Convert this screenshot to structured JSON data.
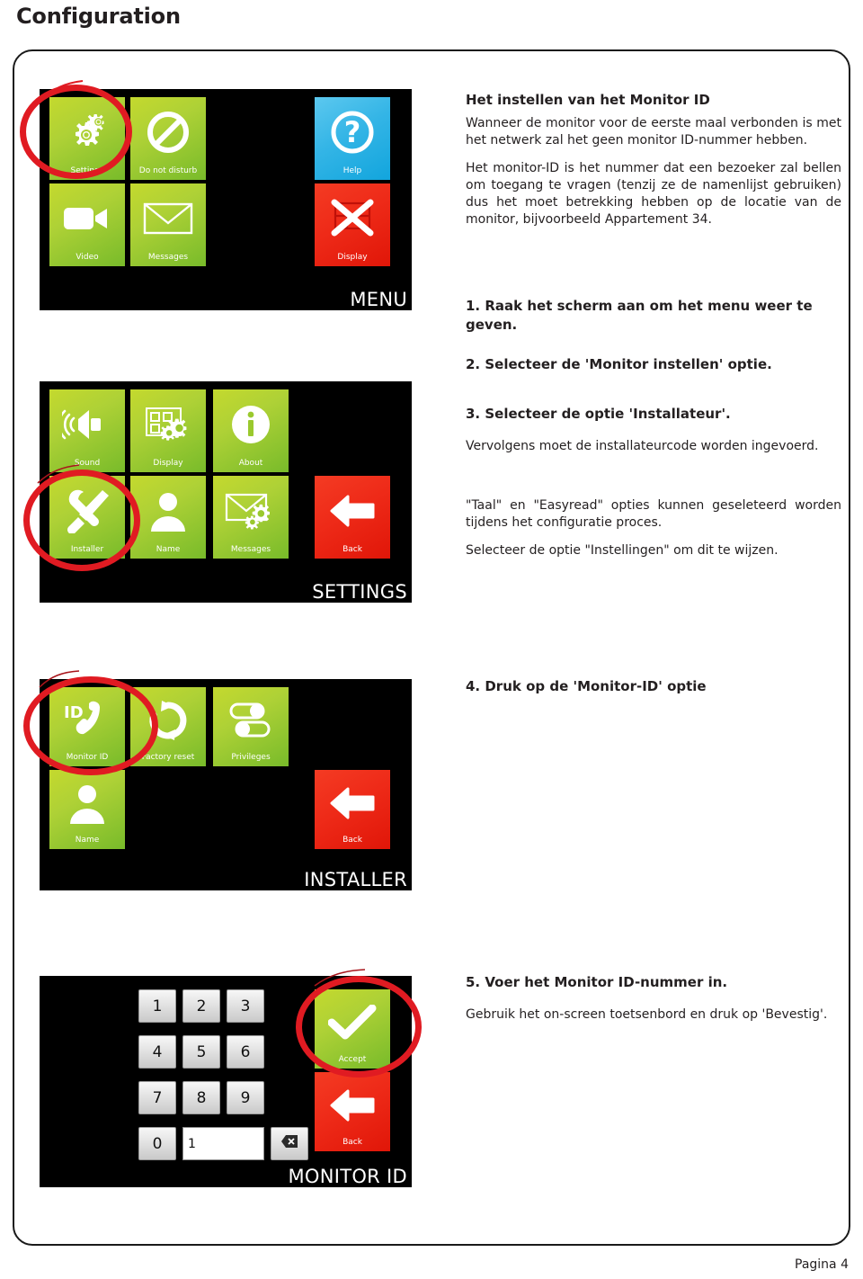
{
  "page": {
    "title": "Configuration",
    "footer": "Pagina 4"
  },
  "colors": {
    "green": "#aed136",
    "red": "#e01608",
    "blue": "#34b5e6",
    "annotation": "#e01b22",
    "screen_bg": "#000000"
  },
  "screens": [
    {
      "name": "menu-screen",
      "caption": "MENU",
      "tiles": [
        {
          "label": "Settings",
          "icon": "gears-icon",
          "color": "green"
        },
        {
          "label": "Do not disturb",
          "icon": "no-entry-icon",
          "color": "green"
        },
        {
          "label": "Help",
          "icon": "question-circle-icon",
          "color": "blue"
        },
        {
          "label": "Video",
          "icon": "video-camera-icon",
          "color": "green"
        },
        {
          "label": "Messages",
          "icon": "envelope-icon",
          "color": "green"
        },
        {
          "label": "Display",
          "icon": "display-off-icon",
          "color": "red"
        }
      ],
      "highlight": "Settings"
    },
    {
      "name": "settings-screen",
      "caption": "SETTINGS",
      "tiles": [
        {
          "label": "Sound",
          "icon": "speaker-icon",
          "color": "green"
        },
        {
          "label": "Display",
          "icon": "display-gears-icon",
          "color": "green"
        },
        {
          "label": "About",
          "icon": "info-circle-icon",
          "color": "green"
        },
        {
          "label": "Installer",
          "icon": "tools-icon",
          "color": "green"
        },
        {
          "label": "Name",
          "icon": "person-icon",
          "color": "green"
        },
        {
          "label": "Messages",
          "icon": "envelope-gears-icon",
          "color": "green"
        },
        {
          "label": "Back",
          "icon": "arrow-left-icon",
          "color": "red"
        }
      ],
      "highlight": "Installer"
    },
    {
      "name": "installer-screen",
      "caption": "INSTALLER",
      "tiles": [
        {
          "label": "Monitor ID",
          "icon": "id-phone-icon",
          "color": "green"
        },
        {
          "label": "Factory reset",
          "icon": "refresh-icon",
          "color": "green"
        },
        {
          "label": "Privileges",
          "icon": "toggles-icon",
          "color": "green"
        },
        {
          "label": "Name",
          "icon": "person-icon",
          "color": "green"
        },
        {
          "label": "Back",
          "icon": "arrow-left-icon",
          "color": "red"
        }
      ],
      "highlight": "Monitor ID"
    },
    {
      "name": "monitor-id-screen",
      "caption": "MONITOR ID",
      "keys": [
        "1",
        "2",
        "3",
        "4",
        "5",
        "6",
        "7",
        "8",
        "9",
        "0"
      ],
      "input_value": "1",
      "backspace_icon": "backspace-icon",
      "tiles": [
        {
          "label": "Accept",
          "icon": "check-icon",
          "color": "green"
        },
        {
          "label": "Back",
          "icon": "arrow-left-icon",
          "color": "red"
        }
      ],
      "highlight": "Accept"
    }
  ],
  "text": {
    "heading": "Het instellen van het Monitor ID",
    "para1": "Wanneer de monitor voor de eerste maal verbonden is met het netwerk zal het geen monitor ID-nummer hebben.",
    "para2": "Het monitor-ID is het nummer dat een bezoeker zal bellen om toegang te vragen (tenzij ze de namenlijst gebruiken) dus het moet betrekking hebben op de locatie van de monitor, bijvoorbeeld Appartement 34.",
    "step1": "1. Raak het scherm aan om het menu weer te geven.",
    "step2": "2. Selecteer de 'Monitor instellen' optie.",
    "step3": "3. Selecteer de optie  'Installateur'.",
    "para3": "Vervolgens moet de installateurcode worden ingevoerd.",
    "para4": "\"Taal\" en \"Easyread\" opties kunnen geseleteerd worden tijdens het configuratie proces.",
    "para5": "Selecteer de optie \"Instellingen\" om dit te wijzen.",
    "step4": "4. Druk op de 'Monitor-ID' optie",
    "step5": "5. Voer het Monitor ID-nummer in.",
    "para6": "Gebruik het on-screen toetsenbord en druk op 'Bevestig'."
  }
}
